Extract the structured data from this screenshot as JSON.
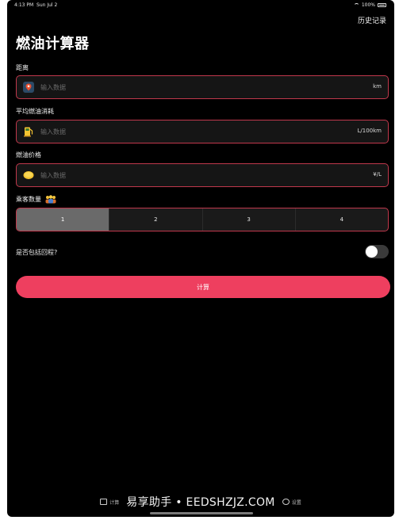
{
  "status": {
    "time": "4:13 PM",
    "date": "Sun Jul 2",
    "battery": "100%"
  },
  "header": {
    "history_link": "历史记录",
    "title": "燃油计算器"
  },
  "form": {
    "distance": {
      "label": "距离",
      "placeholder": "输入数据",
      "unit": "km",
      "icon": "map-pin-icon"
    },
    "consumption": {
      "label": "平均燃油消耗",
      "placeholder": "输入数据",
      "unit": "L/100km",
      "icon": "fuel-pump-icon"
    },
    "price": {
      "label": "燃油价格",
      "placeholder": "输入数据",
      "unit": "¥/L",
      "icon": "coin-icon"
    },
    "passengers": {
      "label": "乘客数量",
      "icon": "people-icon",
      "options": [
        "1",
        "2",
        "3",
        "4"
      ],
      "selected": "1"
    },
    "round_trip": {
      "label": "是否包括回程?",
      "value": false
    },
    "calculate_label": "计算"
  },
  "tabbar": {
    "tab1_label": "计算",
    "watermark": "易享助手 • EEDSHZJZ.COM",
    "tab3_label": "设置"
  },
  "colors": {
    "accent": "#ee3f5f",
    "border": "#c0384c",
    "background": "#000000"
  }
}
